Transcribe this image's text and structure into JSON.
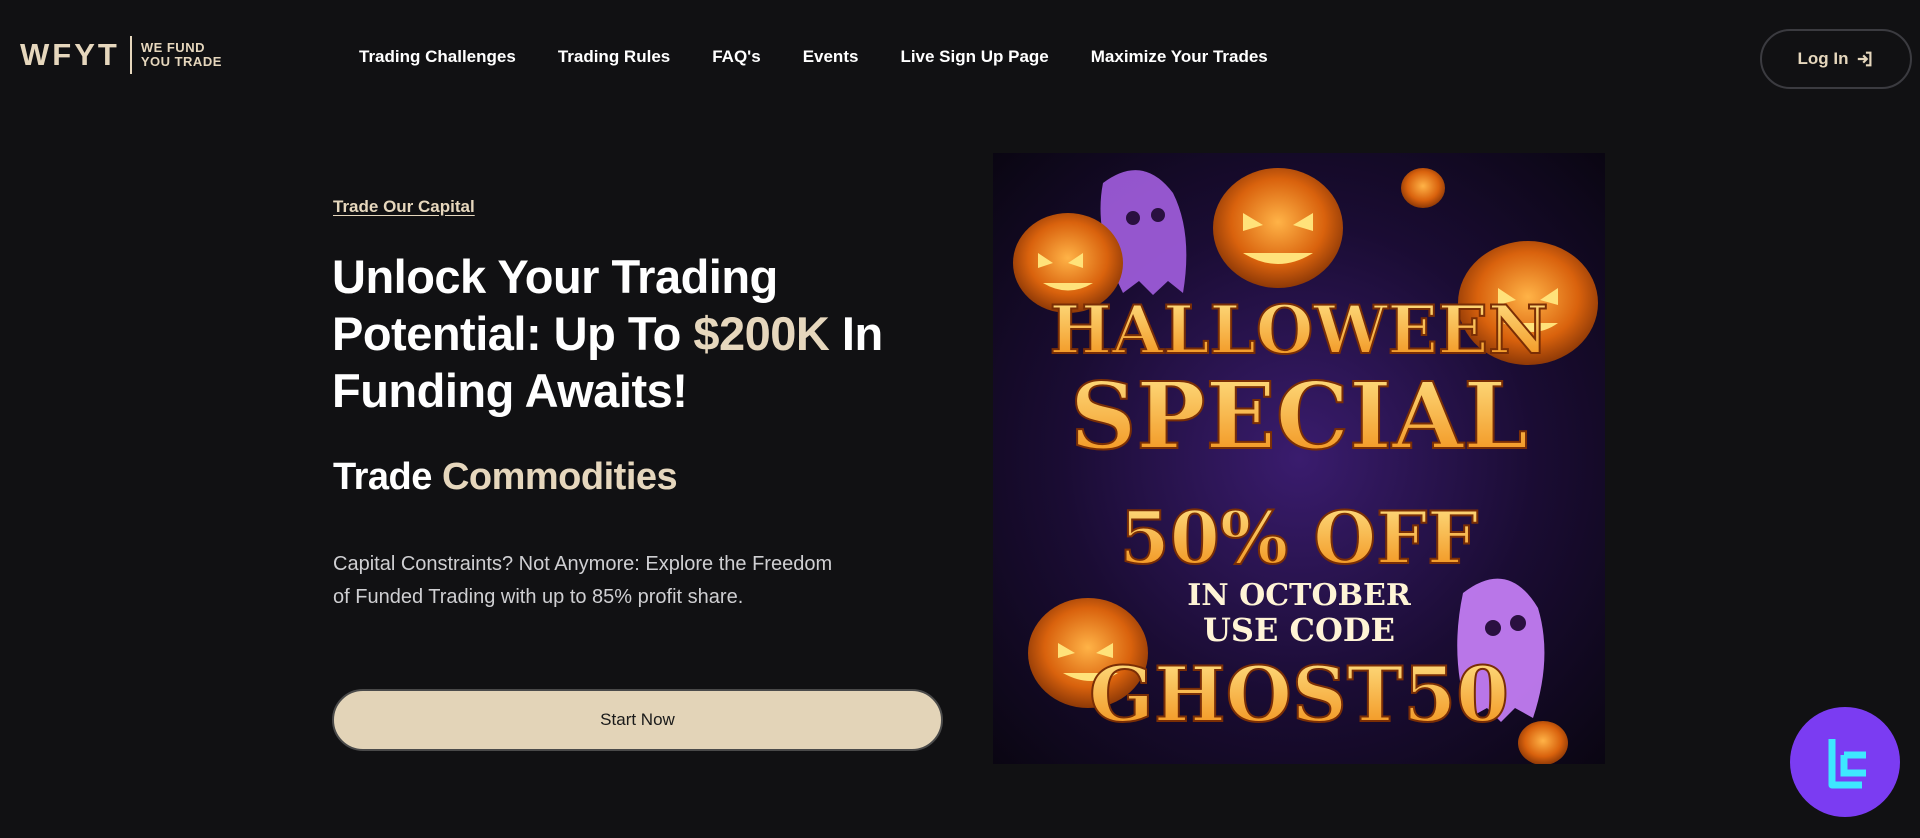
{
  "brand": {
    "mark": "WFYT",
    "tagline_line1": "WE FUND",
    "tagline_line2": "YOU TRADE"
  },
  "nav": {
    "items": [
      {
        "label": "Trading Challenges"
      },
      {
        "label": "Trading Rules"
      },
      {
        "label": "FAQ's"
      },
      {
        "label": "Events"
      },
      {
        "label": "Live Sign Up Page"
      },
      {
        "label": "Maximize Your Trades"
      }
    ],
    "login_label": "Log In"
  },
  "hero": {
    "eyebrow": "Trade Our Capital",
    "headline_part1": "Unlock Your Trading Potential: Up To ",
    "headline_accent": "$200K",
    "headline_part2": " In Funding Awaits!",
    "subhead_part1": "Trade ",
    "subhead_accent": "Commodities",
    "description": "Capital Constraints? Not Anymore: Explore the Freedom of Funded Trading with up to 85% profit share.",
    "cta_label": "Start Now"
  },
  "banner": {
    "line1": "HALLOWEEN",
    "line2": "SPECIAL",
    "line3": "50% OFF",
    "line4": "IN OCTOBER",
    "line5": "USE CODE",
    "line6": "GHOST50"
  },
  "colors": {
    "accent": "#e6d7bd",
    "background": "#111113",
    "badge": "#7b3cf2"
  }
}
